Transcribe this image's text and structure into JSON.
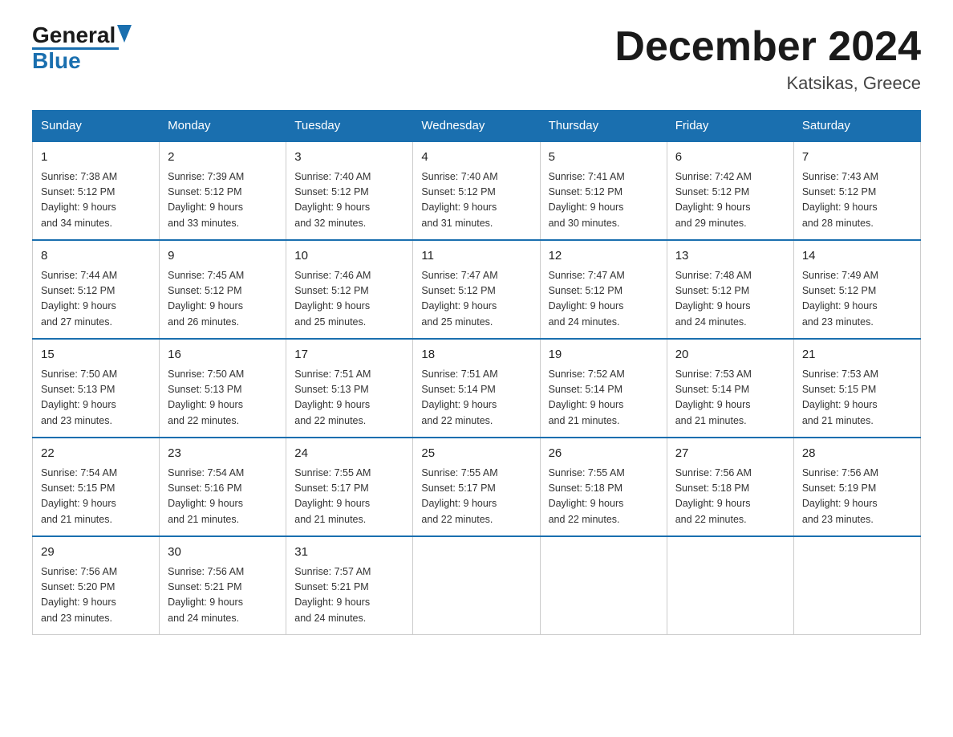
{
  "header": {
    "logo_general": "General",
    "logo_blue": "Blue",
    "title": "December 2024",
    "subtitle": "Katsikas, Greece"
  },
  "days_of_week": [
    "Sunday",
    "Monday",
    "Tuesday",
    "Wednesday",
    "Thursday",
    "Friday",
    "Saturday"
  ],
  "weeks": [
    [
      {
        "day": "1",
        "sunrise": "7:38 AM",
        "sunset": "5:12 PM",
        "daylight": "9 hours and 34 minutes."
      },
      {
        "day": "2",
        "sunrise": "7:39 AM",
        "sunset": "5:12 PM",
        "daylight": "9 hours and 33 minutes."
      },
      {
        "day": "3",
        "sunrise": "7:40 AM",
        "sunset": "5:12 PM",
        "daylight": "9 hours and 32 minutes."
      },
      {
        "day": "4",
        "sunrise": "7:40 AM",
        "sunset": "5:12 PM",
        "daylight": "9 hours and 31 minutes."
      },
      {
        "day": "5",
        "sunrise": "7:41 AM",
        "sunset": "5:12 PM",
        "daylight": "9 hours and 30 minutes."
      },
      {
        "day": "6",
        "sunrise": "7:42 AM",
        "sunset": "5:12 PM",
        "daylight": "9 hours and 29 minutes."
      },
      {
        "day": "7",
        "sunrise": "7:43 AM",
        "sunset": "5:12 PM",
        "daylight": "9 hours and 28 minutes."
      }
    ],
    [
      {
        "day": "8",
        "sunrise": "7:44 AM",
        "sunset": "5:12 PM",
        "daylight": "9 hours and 27 minutes."
      },
      {
        "day": "9",
        "sunrise": "7:45 AM",
        "sunset": "5:12 PM",
        "daylight": "9 hours and 26 minutes."
      },
      {
        "day": "10",
        "sunrise": "7:46 AM",
        "sunset": "5:12 PM",
        "daylight": "9 hours and 25 minutes."
      },
      {
        "day": "11",
        "sunrise": "7:47 AM",
        "sunset": "5:12 PM",
        "daylight": "9 hours and 25 minutes."
      },
      {
        "day": "12",
        "sunrise": "7:47 AM",
        "sunset": "5:12 PM",
        "daylight": "9 hours and 24 minutes."
      },
      {
        "day": "13",
        "sunrise": "7:48 AM",
        "sunset": "5:12 PM",
        "daylight": "9 hours and 24 minutes."
      },
      {
        "day": "14",
        "sunrise": "7:49 AM",
        "sunset": "5:12 PM",
        "daylight": "9 hours and 23 minutes."
      }
    ],
    [
      {
        "day": "15",
        "sunrise": "7:50 AM",
        "sunset": "5:13 PM",
        "daylight": "9 hours and 23 minutes."
      },
      {
        "day": "16",
        "sunrise": "7:50 AM",
        "sunset": "5:13 PM",
        "daylight": "9 hours and 22 minutes."
      },
      {
        "day": "17",
        "sunrise": "7:51 AM",
        "sunset": "5:13 PM",
        "daylight": "9 hours and 22 minutes."
      },
      {
        "day": "18",
        "sunrise": "7:51 AM",
        "sunset": "5:14 PM",
        "daylight": "9 hours and 22 minutes."
      },
      {
        "day": "19",
        "sunrise": "7:52 AM",
        "sunset": "5:14 PM",
        "daylight": "9 hours and 21 minutes."
      },
      {
        "day": "20",
        "sunrise": "7:53 AM",
        "sunset": "5:14 PM",
        "daylight": "9 hours and 21 minutes."
      },
      {
        "day": "21",
        "sunrise": "7:53 AM",
        "sunset": "5:15 PM",
        "daylight": "9 hours and 21 minutes."
      }
    ],
    [
      {
        "day": "22",
        "sunrise": "7:54 AM",
        "sunset": "5:15 PM",
        "daylight": "9 hours and 21 minutes."
      },
      {
        "day": "23",
        "sunrise": "7:54 AM",
        "sunset": "5:16 PM",
        "daylight": "9 hours and 21 minutes."
      },
      {
        "day": "24",
        "sunrise": "7:55 AM",
        "sunset": "5:17 PM",
        "daylight": "9 hours and 21 minutes."
      },
      {
        "day": "25",
        "sunrise": "7:55 AM",
        "sunset": "5:17 PM",
        "daylight": "9 hours and 22 minutes."
      },
      {
        "day": "26",
        "sunrise": "7:55 AM",
        "sunset": "5:18 PM",
        "daylight": "9 hours and 22 minutes."
      },
      {
        "day": "27",
        "sunrise": "7:56 AM",
        "sunset": "5:18 PM",
        "daylight": "9 hours and 22 minutes."
      },
      {
        "day": "28",
        "sunrise": "7:56 AM",
        "sunset": "5:19 PM",
        "daylight": "9 hours and 23 minutes."
      }
    ],
    [
      {
        "day": "29",
        "sunrise": "7:56 AM",
        "sunset": "5:20 PM",
        "daylight": "9 hours and 23 minutes."
      },
      {
        "day": "30",
        "sunrise": "7:56 AM",
        "sunset": "5:21 PM",
        "daylight": "9 hours and 24 minutes."
      },
      {
        "day": "31",
        "sunrise": "7:57 AM",
        "sunset": "5:21 PM",
        "daylight": "9 hours and 24 minutes."
      },
      null,
      null,
      null,
      null
    ]
  ],
  "labels": {
    "sunrise": "Sunrise:",
    "sunset": "Sunset:",
    "daylight": "Daylight:"
  }
}
